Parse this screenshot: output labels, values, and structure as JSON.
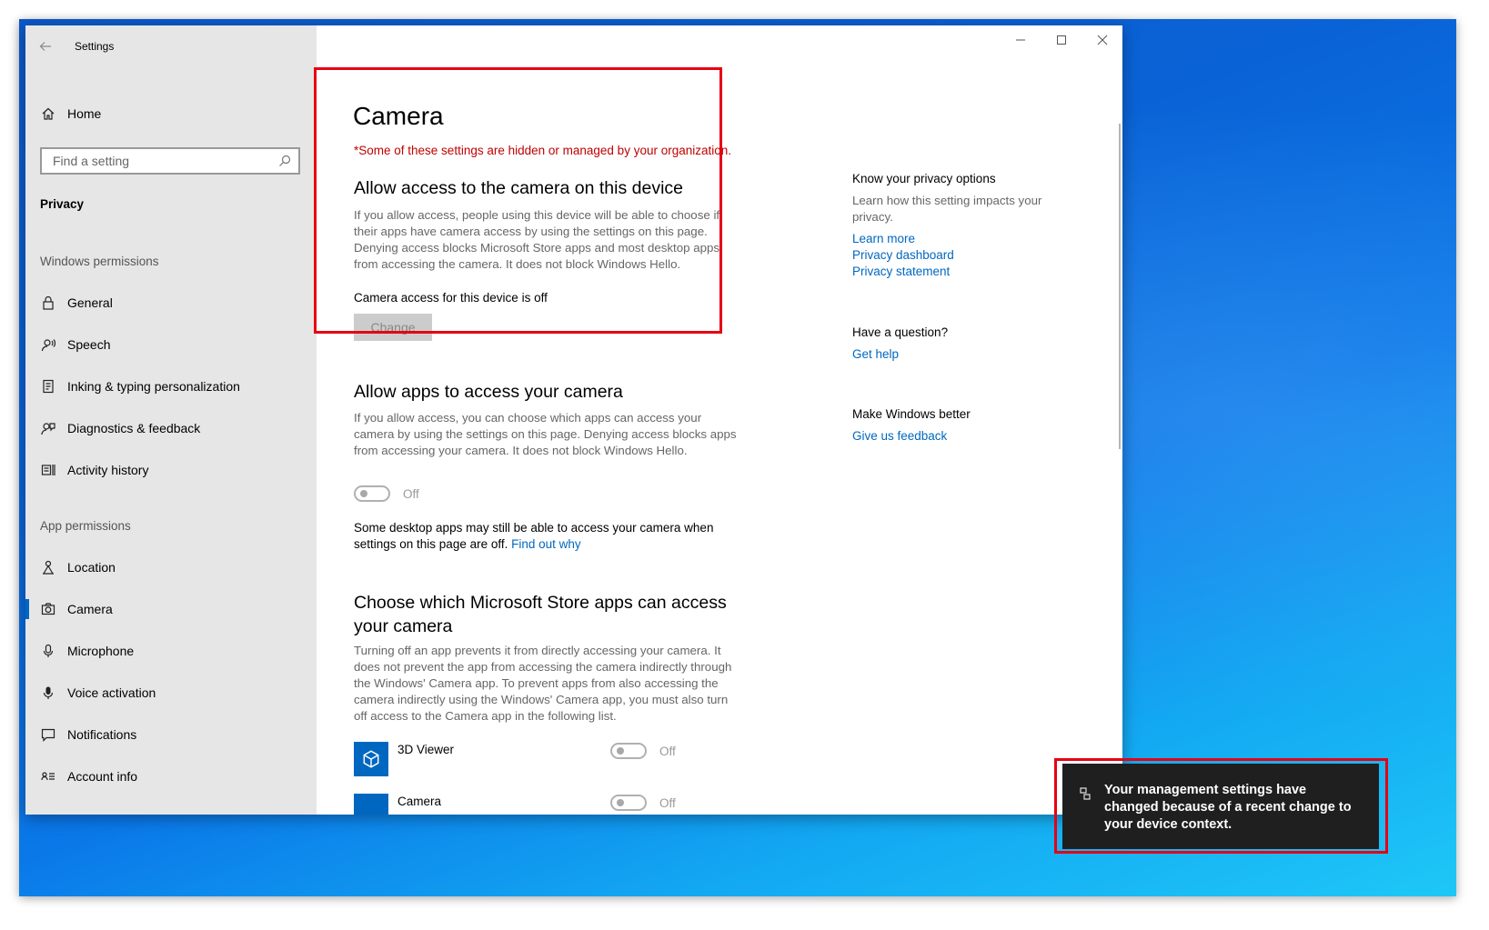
{
  "window": {
    "title": "Settings"
  },
  "sidebar": {
    "home_label": "Home",
    "search_placeholder": "Find a setting",
    "section": "Privacy",
    "windows_permissions_label": "Windows permissions",
    "windows_items": [
      {
        "label": "General",
        "icon": "lock-icon"
      },
      {
        "label": "Speech",
        "icon": "speech-icon"
      },
      {
        "label": "Inking & typing personalization",
        "icon": "inking-icon"
      },
      {
        "label": "Diagnostics & feedback",
        "icon": "diagnostics-icon"
      },
      {
        "label": "Activity history",
        "icon": "activity-icon"
      }
    ],
    "app_permissions_label": "App permissions",
    "app_items": [
      {
        "label": "Location",
        "icon": "location-icon"
      },
      {
        "label": "Camera",
        "icon": "camera-icon",
        "active": true
      },
      {
        "label": "Microphone",
        "icon": "microphone-icon"
      },
      {
        "label": "Voice activation",
        "icon": "voice-icon"
      },
      {
        "label": "Notifications",
        "icon": "notifications-icon"
      },
      {
        "label": "Account info",
        "icon": "account-icon"
      }
    ]
  },
  "main": {
    "title": "Camera",
    "org_note": "*Some of these settings are hidden or managed by your organization.",
    "device_section": {
      "heading": "Allow access to the camera on this device",
      "desc": "If you allow access, people using this device will be able to choose if their apps have camera access by using the settings on this page. Denying access blocks Microsoft Store apps and most desktop apps from accessing the camera. It does not block Windows Hello.",
      "status": "Camera access for this device is off",
      "change_label": "Change"
    },
    "apps_section": {
      "heading": "Allow apps to access your camera",
      "desc": "If you allow access, you can choose which apps can access your camera by using the settings on this page. Denying access blocks apps from accessing your camera. It does not block Windows Hello.",
      "toggle_label": "Off",
      "desktop_note": "Some desktop apps may still be able to access your camera when settings on this page are off.",
      "find_out_why": "Find out why"
    },
    "store_section": {
      "heading": "Choose which Microsoft Store apps can access your camera",
      "desc": "Turning off an app prevents it from directly accessing your camera. It does not prevent the app from accessing the camera indirectly through the Windows' Camera app. To prevent apps from also accessing the camera indirectly using the Windows' Camera app, you must also turn off access to the Camera app in the following list.",
      "apps": [
        {
          "name": "3D Viewer",
          "state": "Off",
          "icon": "3d-viewer-icon"
        },
        {
          "name": "Camera",
          "state": "Off",
          "icon": "camera-app-icon"
        }
      ]
    }
  },
  "right": {
    "privacy_heading": "Know your privacy options",
    "privacy_desc": "Learn how this setting impacts your privacy.",
    "links": [
      "Learn more",
      "Privacy dashboard",
      "Privacy statement"
    ],
    "question_heading": "Have a question?",
    "get_help": "Get help",
    "better_heading": "Make Windows better",
    "feedback": "Give us feedback"
  },
  "toast": {
    "message": "Your management settings have changed because of a recent change to your device context."
  },
  "colors": {
    "accent": "#0067c0",
    "warning": "#c00000",
    "highlight": "#e60012",
    "toast_bg": "#1f1f1f"
  }
}
